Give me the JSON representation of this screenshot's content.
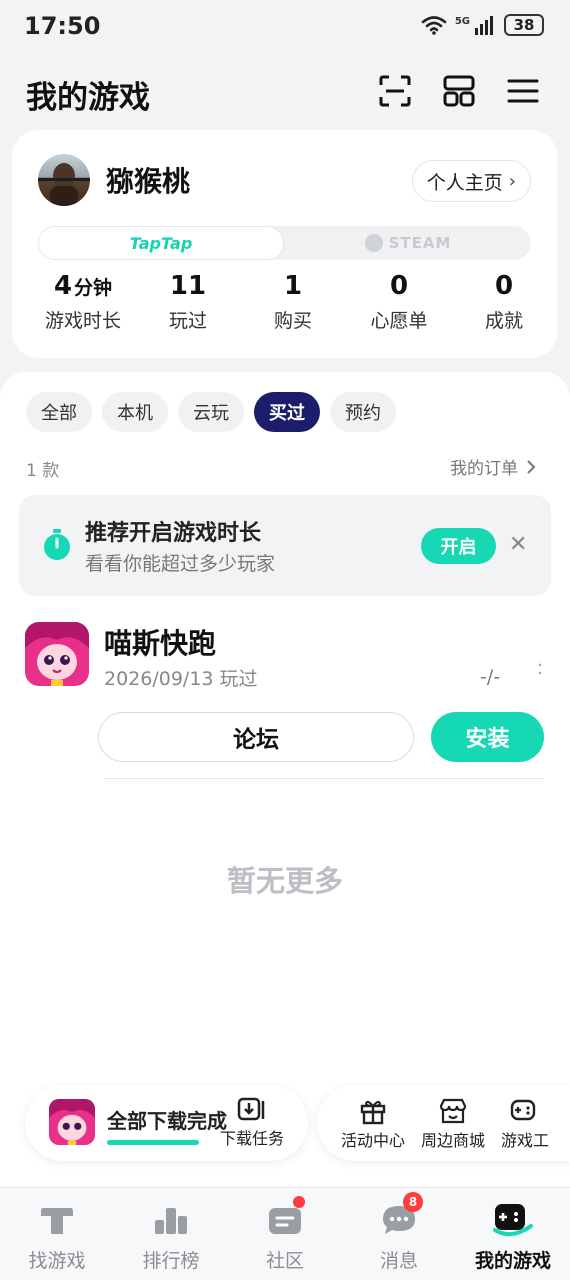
{
  "status_bar": {
    "time": "17:50",
    "network": "5G",
    "battery": "38"
  },
  "header": {
    "title": "我的游戏",
    "icons": [
      "scan-icon",
      "grid-icon",
      "menu-icon"
    ]
  },
  "profile": {
    "username": "猕猴桃",
    "home_button": "个人主页",
    "platforms": {
      "taptap": "TapTap",
      "steam": "STEAM"
    },
    "stats": [
      {
        "value": "4",
        "unit": "分钟",
        "label": "游戏时长"
      },
      {
        "value": "11",
        "label": "玩过"
      },
      {
        "value": "1",
        "label": "购买"
      },
      {
        "value": "0",
        "label": "心愿单"
      },
      {
        "value": "0",
        "label": "成就"
      }
    ]
  },
  "filters": [
    "全部",
    "本机",
    "云玩",
    "买过",
    "预约"
  ],
  "active_filter": "买过",
  "list_info": {
    "count": "1 款",
    "orders_link": "我的订单"
  },
  "tip": {
    "title": "推荐开启游戏时长",
    "subtitle": "看看你能超过多少玩家",
    "button": "开启"
  },
  "game": {
    "name": "喵斯快跑",
    "meta": "2026/09/13 玩过",
    "rating": "-/-",
    "forum_button": "论坛",
    "install_button": "安装"
  },
  "empty_text": "暂无更多",
  "download": {
    "title": "全部下载完成",
    "task_label": "下载任务",
    "progress": 1.0
  },
  "shortcuts": [
    {
      "label": "活动中心",
      "icon": "gift-icon"
    },
    {
      "label": "周边商城",
      "icon": "shop-icon"
    },
    {
      "label": "游戏工",
      "icon": "gamepad-icon"
    }
  ],
  "bottom_nav": [
    {
      "label": "找游戏",
      "icon": "discover-icon"
    },
    {
      "label": "排行榜",
      "icon": "ranking-icon"
    },
    {
      "label": "社区",
      "icon": "community-icon",
      "dot": true
    },
    {
      "label": "消息",
      "icon": "message-icon",
      "badge": "8"
    },
    {
      "label": "我的游戏",
      "icon": "my-games-icon",
      "active": true
    }
  ],
  "colors": {
    "accent": "#16d8b4",
    "chip_active": "#1c1d6b",
    "badge": "#ff3b3b"
  }
}
